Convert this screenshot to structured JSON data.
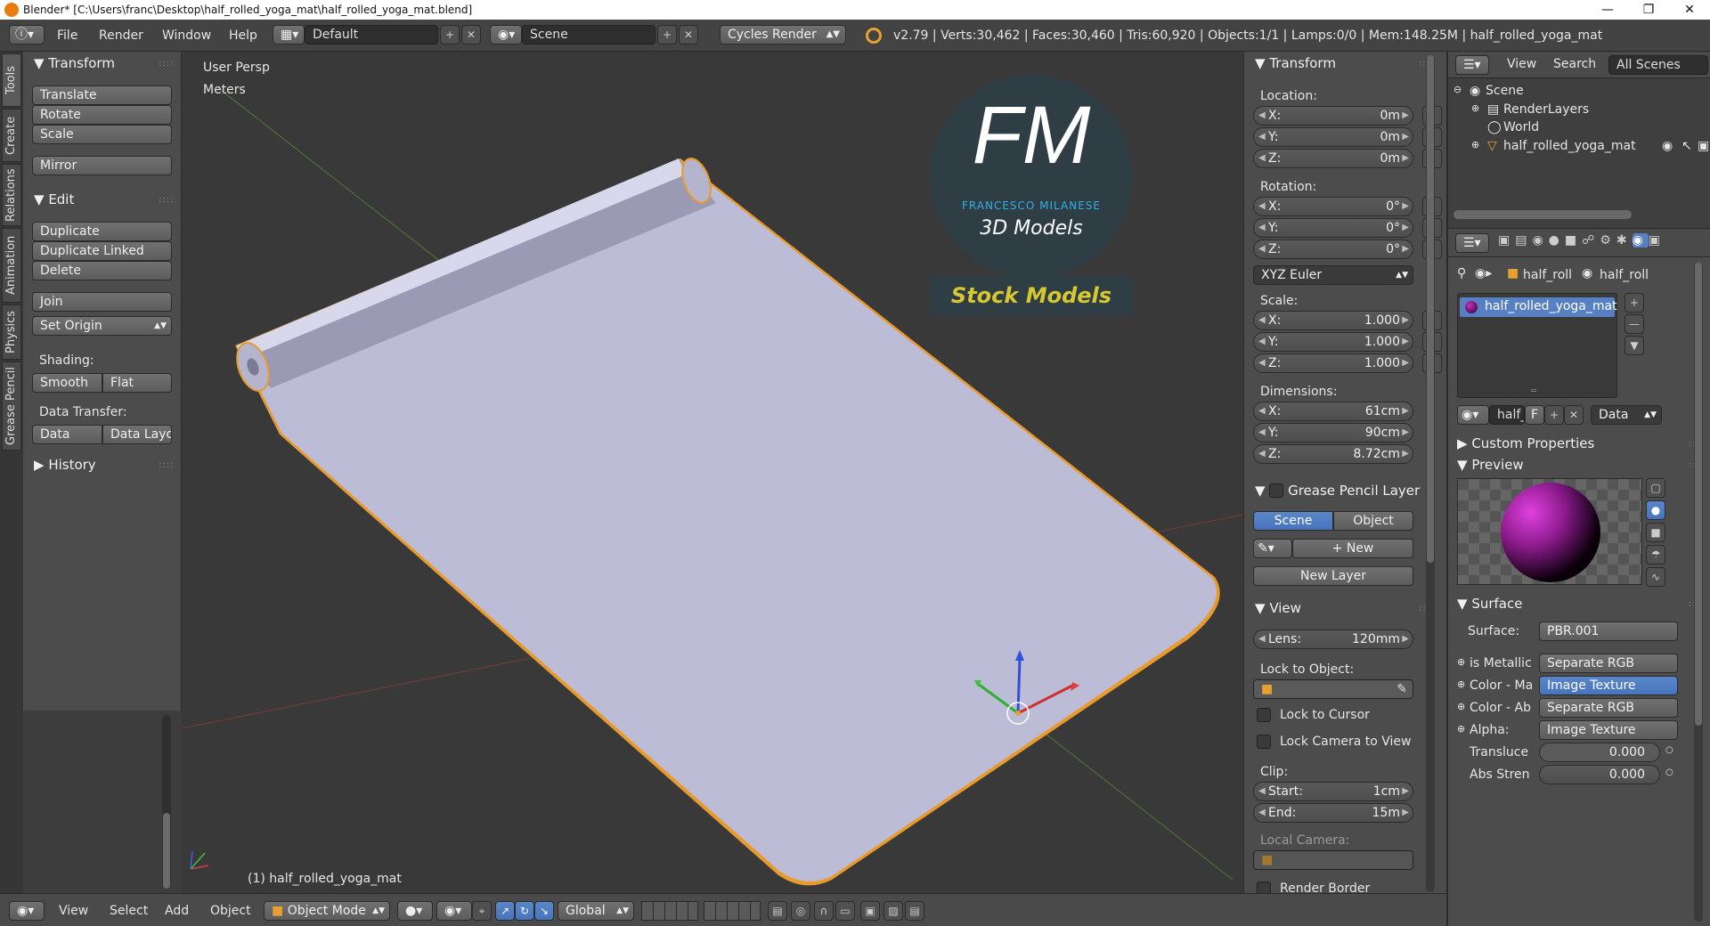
{
  "titlebar": {
    "text": "Blender* [C:\\Users\\franc\\Desktop\\half_rolled_yoga_mat\\half_rolled_yoga_mat.blend]"
  },
  "topbar": {
    "menus": [
      "File",
      "Render",
      "Window",
      "Help"
    ],
    "layout": "Default",
    "scene": "Scene",
    "engine": "Cycles Render",
    "stats": "v2.79 | Verts:30,462 | Faces:30,460 | Tris:60,920 | Objects:1/1 | Lamps:0/0 | Mem:148.25M | half_rolled_yoga_mat"
  },
  "tool_tabs": [
    "Tools",
    "Create",
    "Relations",
    "Animation",
    "Physics",
    "Grease Pencil"
  ],
  "tools": {
    "transform_title": "Transform",
    "translate": "Translate",
    "rotate": "Rotate",
    "scale": "Scale",
    "mirror": "Mirror",
    "edit_title": "Edit",
    "duplicate": "Duplicate",
    "duplicate_linked": "Duplicate Linked",
    "delete": "Delete",
    "join": "Join",
    "set_origin": "Set Origin",
    "shading_label": "Shading:",
    "smooth": "Smooth",
    "flat": "Flat",
    "data_transfer_label": "Data Transfer:",
    "data": "Data",
    "data_layout": "Data Layo",
    "history_title": "History"
  },
  "viewport": {
    "view_name": "User Persp",
    "units": "Meters",
    "object_label": "(1) half_rolled_yoga_mat",
    "logo_letters": "FM",
    "logo_name": "FRANCESCO MILANESE",
    "logo_sub": "3D Models",
    "stock": "Stock Models",
    "mat_color": "#bcbcd6",
    "outline_color": "#e89a2a"
  },
  "props": {
    "transform_title": "Transform",
    "location_label": "Location:",
    "location": [
      {
        "k": "X:",
        "v": "0m"
      },
      {
        "k": "Y:",
        "v": "0m"
      },
      {
        "k": "Z:",
        "v": "0m"
      }
    ],
    "rotation_label": "Rotation:",
    "rotation": [
      {
        "k": "X:",
        "v": "0°"
      },
      {
        "k": "Y:",
        "v": "0°"
      },
      {
        "k": "Z:",
        "v": "0°"
      }
    ],
    "rotation_mode": "XYZ Euler",
    "scale_label": "Scale:",
    "scale": [
      {
        "k": "X:",
        "v": "1.000"
      },
      {
        "k": "Y:",
        "v": "1.000"
      },
      {
        "k": "Z:",
        "v": "1.000"
      }
    ],
    "dimensions_label": "Dimensions:",
    "dimensions": [
      {
        "k": "X:",
        "v": "61cm"
      },
      {
        "k": "Y:",
        "v": "90cm"
      },
      {
        "k": "Z:",
        "v": "8.72cm"
      }
    ],
    "gp_title": "Grease Pencil Layer",
    "gp_scene": "Scene",
    "gp_object": "Object",
    "gp_new": "New",
    "gp_new_layer": "New Layer",
    "view_title": "View",
    "lens_k": "Lens:",
    "lens_v": "120mm",
    "lock_obj_label": "Lock to Object:",
    "lock_cursor": "Lock to Cursor",
    "lock_camera": "Lock Camera to View",
    "clip_label": "Clip:",
    "clip_start_k": "Start:",
    "clip_start_v": "1cm",
    "clip_end_k": "End:",
    "clip_end_v": "15m",
    "local_camera": "Local Camera:",
    "render_border": "Render Border"
  },
  "outliner": {
    "view": "View",
    "search": "Search",
    "all_scenes": "All Scenes",
    "items": [
      "Scene",
      "RenderLayers",
      "World",
      "half_rolled_yoga_mat"
    ]
  },
  "properties": {
    "crumb1": "half_roll",
    "crumb2": "half_roll",
    "material": "half_rolled_yoga_mat",
    "mat_field": "half_r",
    "f_label": "F",
    "data_select": "Data",
    "custom_props": "Custom Properties",
    "preview": "Preview",
    "surface_title": "Surface",
    "surface_k": "Surface:",
    "surface_v": "PBR.001",
    "inputs": [
      {
        "k": "is Metallic",
        "v": "Separate RGB"
      },
      {
        "k": "Color - Ma",
        "v": "Image Texture"
      },
      {
        "k": "Color - Ab",
        "v": "Separate RGB"
      },
      {
        "k": "Alpha:",
        "v": "Image Texture"
      }
    ],
    "translucent_k": "Transluce",
    "translucent_v": "0.000",
    "abs_k": "Abs Stren",
    "abs_v": "0.000"
  },
  "bottombar": {
    "menus": [
      "View",
      "Select",
      "Add",
      "Object"
    ],
    "mode": "Object Mode",
    "orientation": "Global"
  }
}
